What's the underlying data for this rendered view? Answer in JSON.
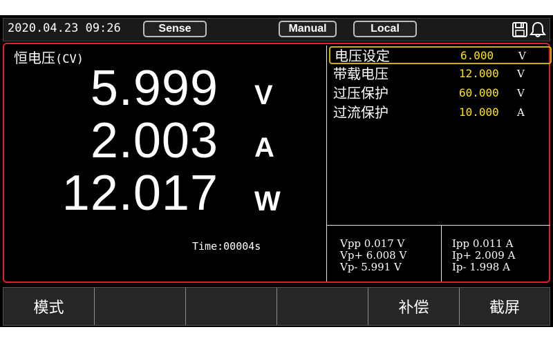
{
  "status_bar": {
    "datetime": "2020.04.23 09:26",
    "sense_label": "Sense",
    "manual_label": "Manual",
    "local_label": "Local",
    "icons": [
      "save-icon",
      "bell-icon"
    ]
  },
  "measure": {
    "mode": "恒电压",
    "mode_abbr": "(CV)",
    "voltage": "5.999",
    "voltage_unit": "V",
    "current": "2.003",
    "current_unit": "A",
    "power": "12.017",
    "power_unit": "W",
    "time": "Time:00004s"
  },
  "settings": [
    {
      "label": "电压设定",
      "value": "6.000",
      "unit": "V",
      "selected": true
    },
    {
      "label": "带载电压",
      "value": "12.000",
      "unit": "V",
      "selected": false
    },
    {
      "label": "过压保护",
      "value": "60.000",
      "unit": "V",
      "selected": false
    },
    {
      "label": "过流保护",
      "value": "10.000",
      "unit": "A",
      "selected": false
    }
  ],
  "stats_left": [
    "Vpp 0.017 V",
    "Vp+ 6.008 V",
    "Vp- 5.991 V"
  ],
  "stats_right": [
    "Ipp 0.011 A",
    "Ip+ 2.009 A",
    "Ip- 1.998 A"
  ],
  "softkeys": [
    "模式",
    "",
    "",
    "",
    "补偿",
    "截屏"
  ],
  "colors": {
    "frame": "#e0202a",
    "value_yellow": "#ffe600",
    "select_border": "#c8b400"
  }
}
